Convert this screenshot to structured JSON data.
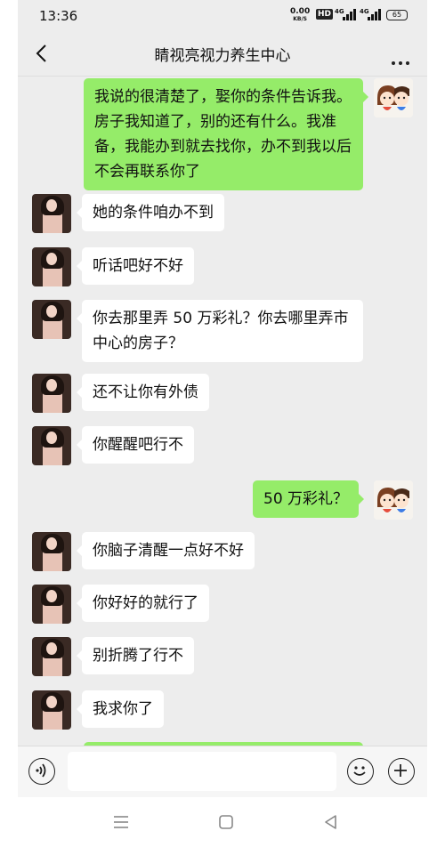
{
  "status_bar": {
    "time": "13:36",
    "net_speed_value": "0.00",
    "net_speed_unit": "KB/S",
    "hd_label": "HD",
    "signal1_label": "4G",
    "signal2_label": "4G",
    "battery": "65"
  },
  "header": {
    "title": "睛视亮视力养生中心"
  },
  "messages": [
    {
      "side": "right",
      "text": "我说的很清楚了，娶你的条件告诉我。房子我知道了，别的还有什么。我准备，我能办到就去找你，办不到我以后不会再联系你了"
    },
    {
      "side": "left",
      "text": "她的条件咱办不到"
    },
    {
      "side": "left",
      "text": "听话吧好不好"
    },
    {
      "side": "left",
      "text": "你去那里弄 50 万彩礼？你去哪里弄市中心的房子？"
    },
    {
      "side": "left",
      "text": "还不让你有外债"
    },
    {
      "side": "left",
      "text": "你醒醒吧行不"
    },
    {
      "side": "right",
      "text": "50 万彩礼？"
    },
    {
      "side": "left",
      "text": "你脑子清醒一点好不好"
    },
    {
      "side": "left",
      "text": "你好好的就行了"
    },
    {
      "side": "left",
      "text": "别折腾了行不"
    },
    {
      "side": "left",
      "text": "我求你了"
    }
  ],
  "icons": {
    "back": "chevron-left-icon",
    "more": "more-dots-icon",
    "voice": "voice-icon",
    "emoji": "emoji-icon",
    "plus": "plus-icon",
    "nav_menu": "menu-icon",
    "nav_home": "home-square-icon",
    "nav_back": "back-triangle-icon"
  },
  "colors": {
    "background": "#ededed",
    "sent_bubble": "#95ec69",
    "received_bubble": "#ffffff"
  }
}
